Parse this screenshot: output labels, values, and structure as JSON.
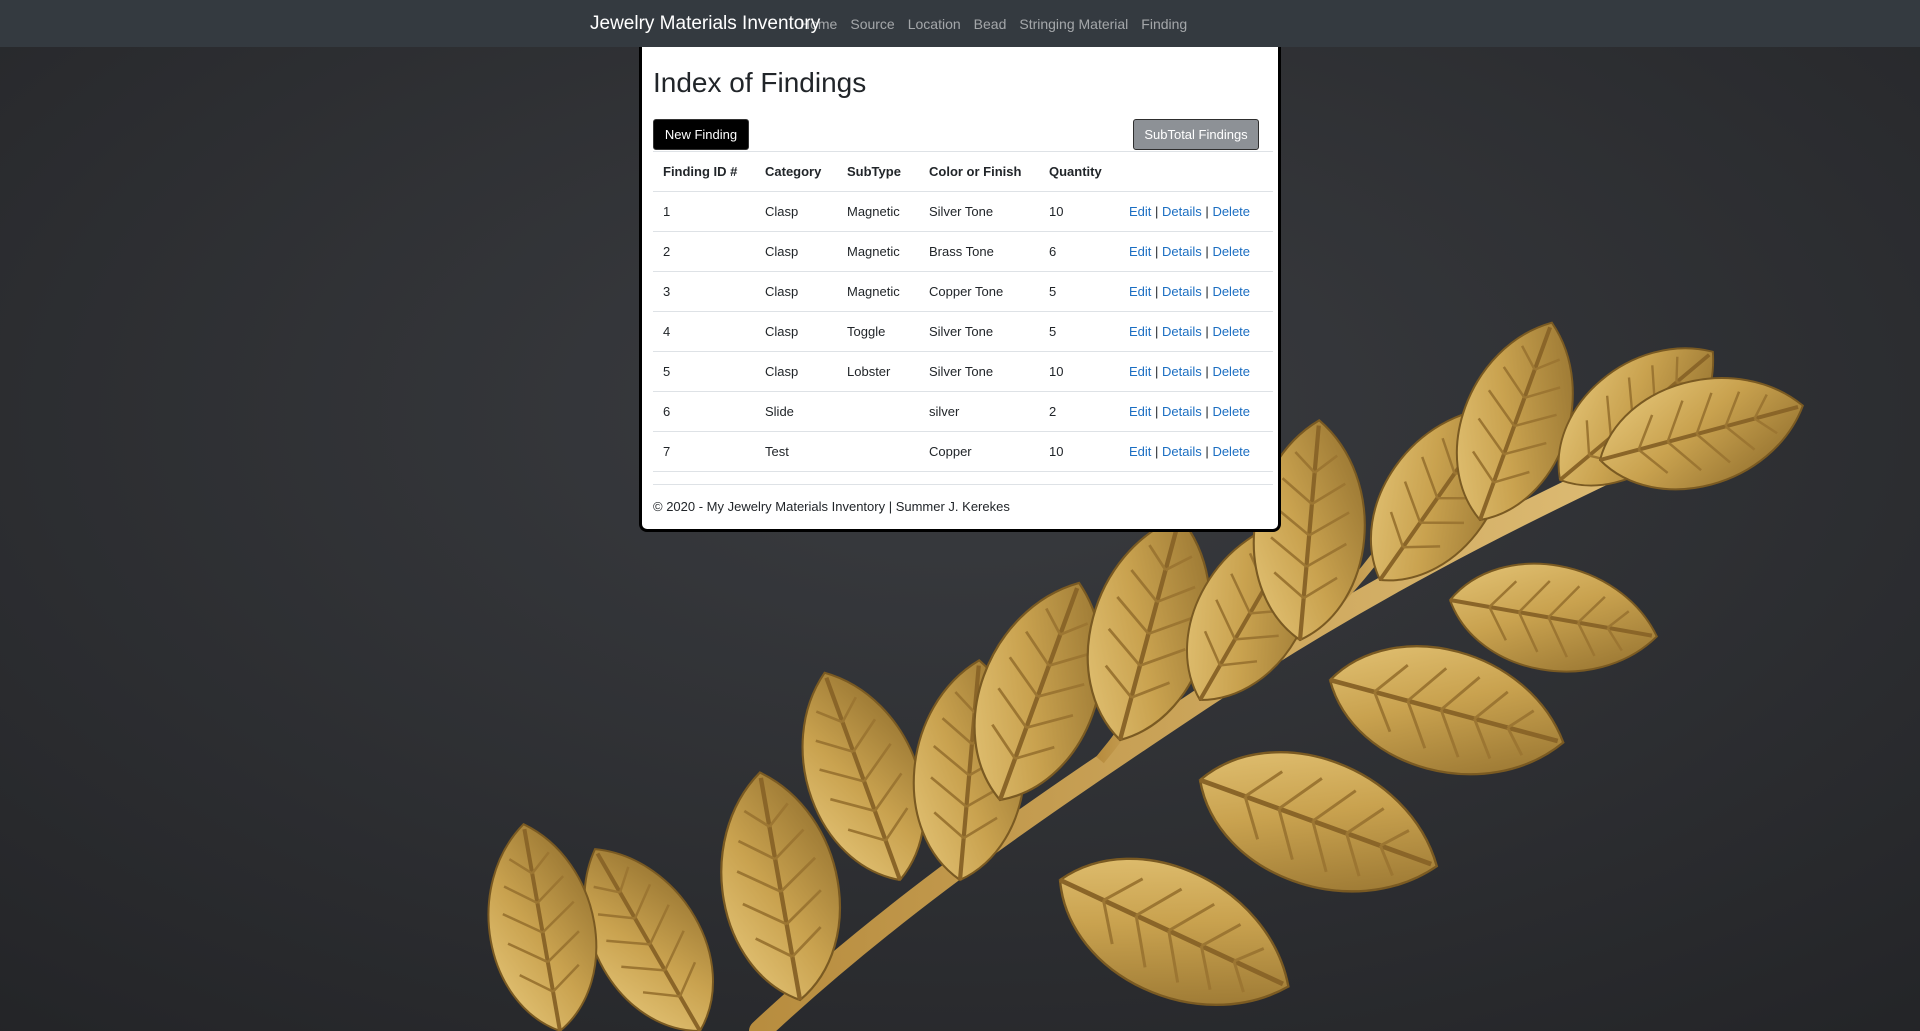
{
  "navbar": {
    "brand": "Jewelry Materials Inventory",
    "links": [
      "Home",
      "Source",
      "Location",
      "Bead",
      "Stringing Material",
      "Finding"
    ]
  },
  "page": {
    "title": "Index of Findings",
    "new_button": "New Finding",
    "subtotal_button": "SubTotal Findings"
  },
  "table": {
    "headers": [
      "Finding ID #",
      "Category",
      "SubType",
      "Color or Finish",
      "Quantity"
    ],
    "actions": {
      "edit": "Edit",
      "details": "Details",
      "delete": "Delete",
      "separator": "|"
    },
    "rows": [
      {
        "id": "1",
        "category": "Clasp",
        "subtype": "Magnetic",
        "color": "Silver Tone",
        "quantity": "10"
      },
      {
        "id": "2",
        "category": "Clasp",
        "subtype": "Magnetic",
        "color": "Brass Tone",
        "quantity": "6"
      },
      {
        "id": "3",
        "category": "Clasp",
        "subtype": "Magnetic",
        "color": "Copper Tone",
        "quantity": "5"
      },
      {
        "id": "4",
        "category": "Clasp",
        "subtype": "Toggle",
        "color": "Silver Tone",
        "quantity": "5"
      },
      {
        "id": "5",
        "category": "Clasp",
        "subtype": "Lobster",
        "color": "Silver Tone",
        "quantity": "10"
      },
      {
        "id": "6",
        "category": "Slide",
        "subtype": "",
        "color": "silver",
        "quantity": "2"
      },
      {
        "id": "7",
        "category": "Test",
        "subtype": "",
        "color": "Copper",
        "quantity": "10"
      }
    ]
  },
  "footer": {
    "text": "© 2020 - My Jewelry Materials Inventory | Summer J. Kerekes"
  },
  "colors": {
    "navbar_bg": "#343a40",
    "link": "#1b6ec2",
    "background": "#2b2d31",
    "leaf_gold": "#c9a24f"
  },
  "background_image": "gold-leaf-branch"
}
